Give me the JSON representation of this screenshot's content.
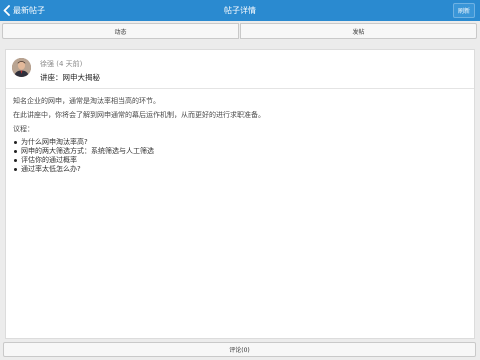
{
  "navbar": {
    "back_label": "最新帖子",
    "title": "帖子详情",
    "refresh_label": "刷新"
  },
  "tabs": [
    {
      "label": "动态"
    },
    {
      "label": "发帖"
    }
  ],
  "post": {
    "author": "徐强 (4 天前)",
    "title": "讲座：网申大揭秘",
    "paragraphs": [
      "知名企业的网申，通常是淘汰率相当高的环节。",
      "在此讲座中，你将会了解到网申通常的幕后运作机制，从而更好的进行求职准备。"
    ],
    "agenda_label": "议程：",
    "agenda": [
      "为什么网申淘汰率高?",
      "网申的两大筛选方式：系统筛选与人工筛选",
      "评估你的通过概率",
      "通过率太低怎么办?"
    ]
  },
  "comment_button": "评论(0)",
  "colors": {
    "navbar": "#2a8ad0",
    "background": "#ececec"
  }
}
